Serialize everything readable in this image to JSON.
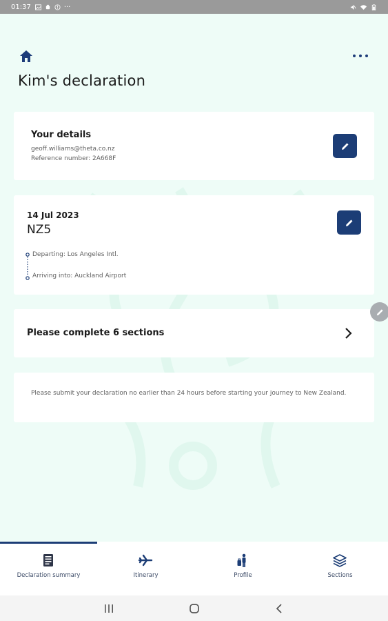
{
  "status_bar": {
    "time": "01:37",
    "left_icons": [
      "image-icon",
      "android-icon",
      "alert-circle-icon"
    ],
    "more_indicator": "···",
    "right_icons": [
      "mute-icon",
      "wifi-icon",
      "battery-icon"
    ]
  },
  "header": {
    "title": "Kim's declaration",
    "home_icon": "home-icon",
    "more_icon": "more-icon"
  },
  "details_card": {
    "title": "Your details",
    "email": "geoff.williams@theta.co.nz",
    "reference": "Reference number:  2A668F",
    "edit_icon": "edit-icon"
  },
  "itinerary_card": {
    "date": "14 Jul 2023",
    "flight": "NZ5",
    "departing": "Departing: Los Angeles Intl.",
    "arriving": "Arriving into: Auckland Airport",
    "edit_icon": "edit-icon"
  },
  "sections_card": {
    "label": "Please complete 6 sections",
    "chevron_icon": "chevron-right-icon"
  },
  "notice_card": {
    "text": "Please submit your declaration no earlier than 24 hours before starting your journey to New Zealand."
  },
  "tabs": [
    {
      "label": "Declaration summary",
      "icon": "document-icon",
      "active": true
    },
    {
      "label": "Itinerary",
      "icon": "plane-icon",
      "active": false
    },
    {
      "label": "Profile",
      "icon": "traveller-icon",
      "active": false
    },
    {
      "label": "Sections",
      "icon": "layers-icon",
      "active": false
    }
  ],
  "colors": {
    "accent": "#1c3d76",
    "background": "#eefcf7",
    "card": "#ffffff",
    "status_bar": "#9a9a9a"
  }
}
